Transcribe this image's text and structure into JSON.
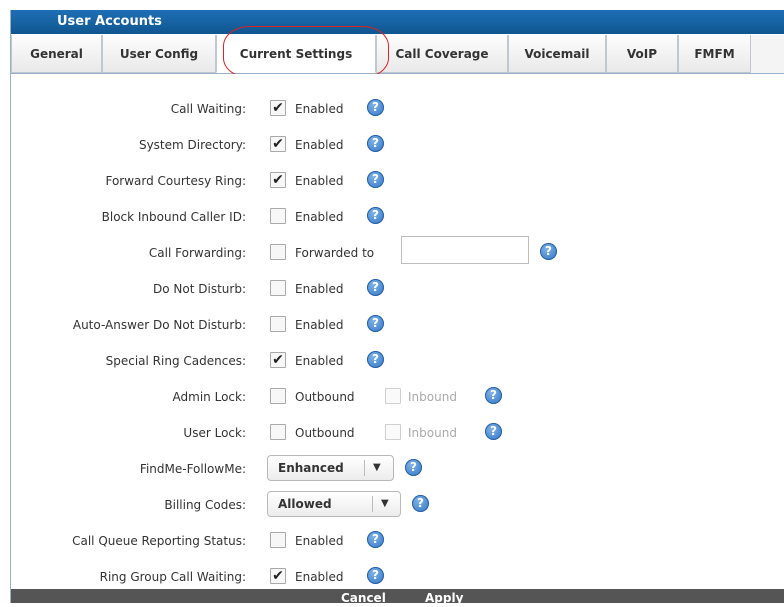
{
  "window": {
    "title": "User Accounts"
  },
  "tabs": [
    {
      "label": "General"
    },
    {
      "label": "User Config"
    },
    {
      "label": "Current Settings"
    },
    {
      "label": "Call Coverage"
    },
    {
      "label": "Voicemail"
    },
    {
      "label": "VoIP"
    },
    {
      "label": "FMFM"
    }
  ],
  "settings": {
    "call_waiting": {
      "label": "Call Waiting:",
      "option": "Enabled",
      "checked": true
    },
    "system_directory": {
      "label": "System Directory:",
      "option": "Enabled",
      "checked": true
    },
    "forward_courtesy_ring": {
      "label": "Forward Courtesy Ring:",
      "option": "Enabled",
      "checked": true
    },
    "block_inbound_caller_id": {
      "label": "Block Inbound Caller ID:",
      "option": "Enabled",
      "checked": false
    },
    "call_forwarding": {
      "label": "Call Forwarding:",
      "option": "Forwarded to",
      "checked": false,
      "value": ""
    },
    "do_not_disturb": {
      "label": "Do Not Disturb:",
      "option": "Enabled",
      "checked": false
    },
    "auto_answer_dnd": {
      "label": "Auto-Answer Do Not Disturb:",
      "option": "Enabled",
      "checked": false
    },
    "special_ring_cadences": {
      "label": "Special Ring Cadences:",
      "option": "Enabled",
      "checked": true
    },
    "admin_lock": {
      "label": "Admin Lock:",
      "option1": "Outbound",
      "option2": "Inbound"
    },
    "user_lock": {
      "label": "User Lock:",
      "option1": "Outbound",
      "option2": "Inbound"
    },
    "findme_followme": {
      "label": "FindMe-FollowMe:",
      "selected": "Enhanced"
    },
    "billing_codes": {
      "label": "Billing Codes:",
      "selected": "Allowed"
    },
    "call_queue_reporting": {
      "label": "Call Queue Reporting Status:",
      "option": "Enabled",
      "checked": false
    },
    "ring_group_call_waiting": {
      "label": "Ring Group Call Waiting:",
      "option": "Enabled",
      "checked": true
    }
  },
  "glyphs": {
    "check": "✔",
    "help": "?",
    "dropdown": "▼"
  },
  "footer": {
    "cancel": "Cancel",
    "apply": "Apply"
  },
  "colors": {
    "title_bar": "#1a66ad",
    "footer": "#555555",
    "help_icon": "#2d72c4",
    "highlight": "#dd2222"
  }
}
